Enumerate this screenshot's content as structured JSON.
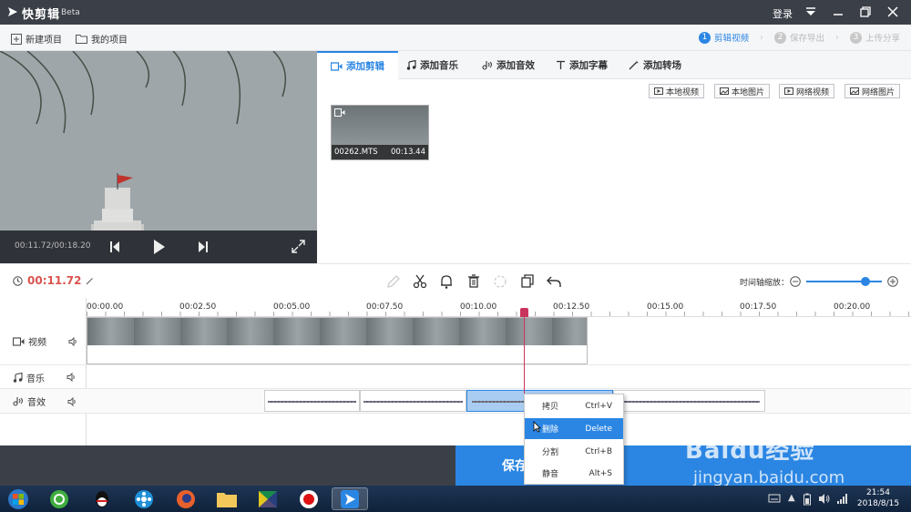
{
  "titlebar": {
    "app_name": "快剪辑",
    "beta": "Beta",
    "login": "登录"
  },
  "toolbar": {
    "new_project": "新建项目",
    "my_projects": "我的项目",
    "steps": [
      {
        "num": "1",
        "label": "剪辑视频"
      },
      {
        "num": "2",
        "label": "保存导出"
      },
      {
        "num": "3",
        "label": "上传分享"
      }
    ]
  },
  "preview": {
    "time": "00:11.72/00:18.20"
  },
  "tabs": [
    {
      "label": "添加剪辑"
    },
    {
      "label": "添加音乐"
    },
    {
      "label": "添加音效"
    },
    {
      "label": "添加字幕"
    },
    {
      "label": "添加转场"
    }
  ],
  "sources": [
    {
      "label": "本地视频"
    },
    {
      "label": "本地图片"
    },
    {
      "label": "网络视频"
    },
    {
      "label": "网络图片"
    }
  ],
  "media": {
    "name": "00262.MTS",
    "duration": "00:13.44"
  },
  "edit": {
    "current_time": "00:11.72",
    "zoom_label": "时间轴缩放："
  },
  "ruler": [
    "00:00.00",
    "00:02.50",
    "00:05.00",
    "00:07.50",
    "00:10.00",
    "00:12.50",
    "00:15.00",
    "00:17.50",
    "00:20.00"
  ],
  "tracks": {
    "video": "视频",
    "music": "音乐",
    "sfx": "音效"
  },
  "save_button": "保存",
  "context_menu": [
    {
      "label": "拷贝",
      "shortcut": "Ctrl+V"
    },
    {
      "label": "删除",
      "shortcut": "Delete"
    },
    {
      "label": "分割",
      "shortcut": "Ctrl+B"
    },
    {
      "label": "静音",
      "shortcut": "Alt+S"
    }
  ],
  "clock": {
    "time": "21:54",
    "date": "2018/8/15"
  },
  "watermark": {
    "brand": "Baidu经验",
    "url": "jingyan.baidu.com"
  },
  "colors": {
    "accent": "#2b86e3",
    "title_bar": "#3b3f48",
    "time_red": "#d9534f",
    "playhead": "#c9345d"
  }
}
